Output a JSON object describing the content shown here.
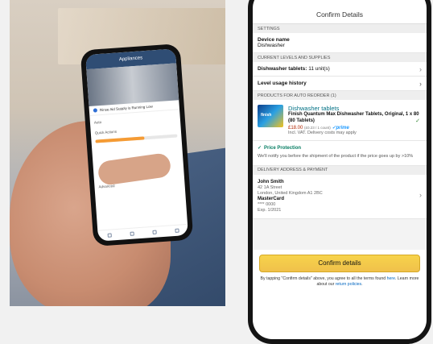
{
  "small_phone": {
    "title": "Appliances",
    "row_text": "Rinse Aid Supply is Running Low",
    "section_auto": "Auto",
    "section_quick": "Quick Actions",
    "advanced": "Advanced"
  },
  "screen": {
    "header_title": "Confirm Details",
    "settings_label": "SETTINGS",
    "device_name_label": "Device name",
    "device_name_value": "Dishwasher",
    "levels_label": "CURRENT LEVELS AND SUPPLIES",
    "supply_item_label": "Dishwasher tablets:",
    "supply_item_value": "11 unit(s)",
    "usage_history": "Level usage history",
    "auto_reorder_label": "PRODUCTS FOR AUTO REORDER",
    "auto_reorder_count": "(1)",
    "product": {
      "category": "Dishwasher tablets",
      "name": "Finish Quantum Max Dishwasher Tablets, Original, 1 x 80 (80 Tablets)",
      "price": "£18.00",
      "unit_price": "(£0.23 / 1 count)",
      "prime": "prime",
      "vat_note": "Incl. VAT. Delivery costs may apply",
      "brand": "finish"
    },
    "protection": {
      "title": "Price Protection",
      "text": "We'll notify you before the shipment of the product if the price goes up by >10%"
    },
    "delivery_label": "DELIVERY ADDRESS & PAYMENT",
    "address": {
      "name": "John Smith",
      "line1": "42 1A Street",
      "line2": "London, United Kingdom A1 2BC",
      "card": "MasterCard",
      "card_number": "**** 0000",
      "expiry": "Exp. 1/2021"
    },
    "confirm_button": "Confirm details",
    "legal_prefix": "By tapping \"Confirm details\" above, you agree to all the terms found",
    "legal_here": "here",
    "legal_mid": ". Learn more about our",
    "legal_link": "return policies",
    "legal_end": "."
  }
}
